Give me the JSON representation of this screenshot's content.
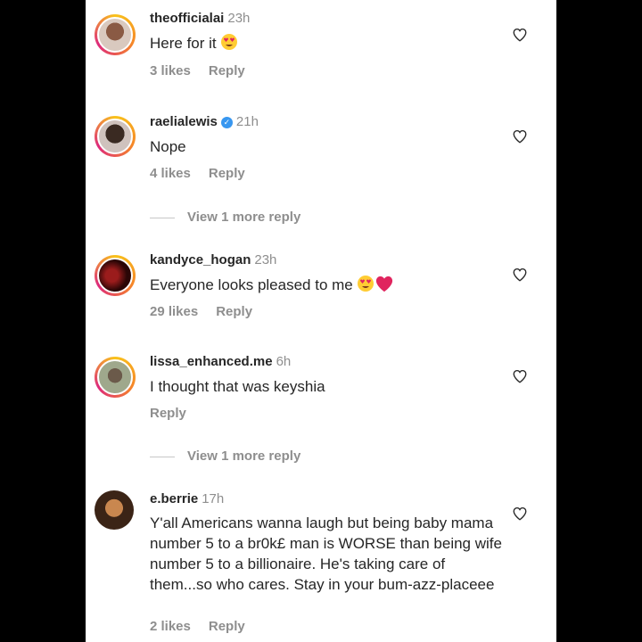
{
  "comments": [
    {
      "username": "theofficialai",
      "time": "23h",
      "text": "Here for it",
      "emoji": [
        "heart-eyes"
      ],
      "likes": "3 likes",
      "reply": "Reply",
      "verified": false,
      "story_ring": true
    },
    {
      "username": "raelialewis",
      "time": "21h",
      "text": "Nope",
      "emoji": [],
      "likes": "4 likes",
      "reply": "Reply",
      "verified": true,
      "story_ring": true
    },
    {
      "username": "kandyce_hogan",
      "time": "23h",
      "text": "Everyone looks pleased to me",
      "emoji": [
        "heart-eyes",
        "red-heart"
      ],
      "likes": "29 likes",
      "reply": "Reply",
      "verified": false,
      "story_ring": true
    },
    {
      "username": "lissa_enhanced.me",
      "time": "6h",
      "text": "I thought that was keyshia",
      "emoji": [],
      "likes": "",
      "reply": "Reply",
      "verified": false,
      "story_ring": true
    },
    {
      "username": "e.berrie",
      "time": "17h",
      "text": "Y'all Americans wanna laugh but being baby mama number 5 to a br0k£ man is WORSE than being wife number 5 to a billionaire. He's taking care of them...so who cares. Stay in your bum-azz-placeee",
      "emoji": [],
      "likes": "2 likes",
      "reply": "Reply",
      "verified": false,
      "story_ring": false
    }
  ],
  "view_more_replies": [
    "View 1 more reply",
    "View 1 more reply"
  ],
  "colors": {
    "background": "#000000",
    "panel": "#ffffff",
    "text": "#262626",
    "secondary": "#8e8e8e",
    "verified": "#3897f0",
    "heart_emoji": "#e0245e"
  },
  "icons": {
    "like": "heart-outline-icon",
    "verified": "verified-badge-icon"
  }
}
